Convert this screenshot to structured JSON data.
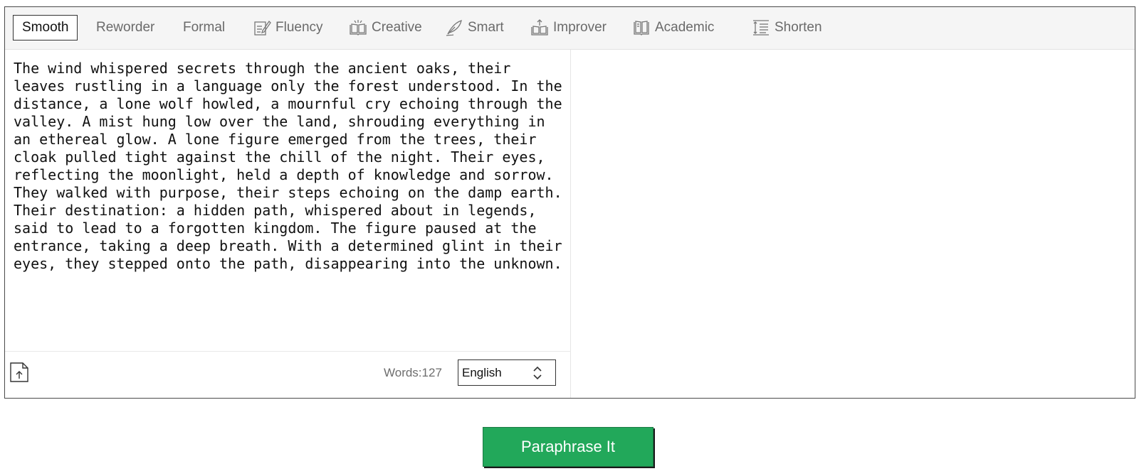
{
  "modes": [
    {
      "label": "Smooth",
      "icon": "none",
      "active": true
    },
    {
      "label": "Reworder",
      "icon": "none",
      "active": false
    },
    {
      "label": "Formal",
      "icon": "none",
      "active": false
    },
    {
      "label": "Fluency",
      "icon": "pen-paper-icon",
      "active": false
    },
    {
      "label": "Creative",
      "icon": "open-book-sparkle-icon",
      "active": false
    },
    {
      "label": "Smart",
      "icon": "feather-pen-icon",
      "active": false
    },
    {
      "label": "Improver",
      "icon": "book-upload-icon",
      "active": false
    },
    {
      "label": "Academic",
      "icon": "book-icon",
      "active": false
    },
    {
      "label": "Shorten",
      "icon": "line-height-icon",
      "active": false
    }
  ],
  "input": {
    "text": "The wind whispered secrets through the ancient oaks, their\nleaves rustling in a language only the forest understood. In the\ndistance, a lone wolf howled, a mournful cry echoing through the\nvalley. A mist hung low over the land, shrouding everything in\nan ethereal glow. A lone figure emerged from the trees, their\ncloak pulled tight against the chill of the night. Their eyes,\nreflecting the moonlight, held a depth of knowledge and sorrow.\nThey walked with purpose, their steps echoing on the damp earth.\nTheir destination: a hidden path, whispered about in legends,\nsaid to lead to a forgotten kingdom. The figure paused at the\nentrance, taking a deep breath. With a determined glint in their\neyes, they stepped onto the path, disappearing into the unknown."
  },
  "footer": {
    "words_label": "Words:127",
    "language": "English",
    "upload_icon": "file-upload-icon"
  },
  "action": {
    "paraphrase_label": "Paraphrase It",
    "color": "#22a85a"
  }
}
